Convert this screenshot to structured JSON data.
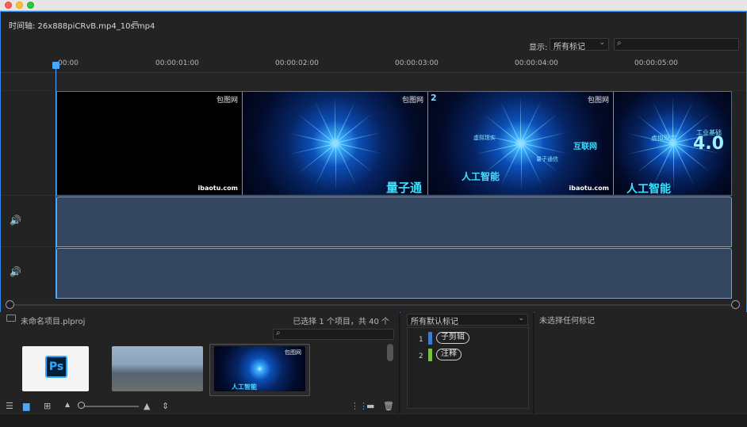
{
  "window": {
    "title": ""
  },
  "timeline": {
    "title": "时间轴: 26x888piCRvB.mp4_10s.mp4",
    "filter_label": "显示:",
    "filter_value": "所有标记",
    "search_placeholder": "",
    "ruler_labels": [
      "00:00",
      "00:00:01:00",
      "00:00:02:00",
      "00:00:03:00",
      "00:00:04:00",
      "00:00:05:00"
    ],
    "playhead": "00:00",
    "clips": [
      {
        "watermark": "包图网",
        "site": "ibaotu.com"
      },
      {
        "watermark": "包图网",
        "site": "",
        "overlay": "量子通"
      },
      {
        "watermark": "包图网",
        "site": "ibaotu.com",
        "overlay": "人工智能",
        "number": "2",
        "labels": [
          "虚拟现实",
          "互联网",
          "量子通信"
        ]
      },
      {
        "watermark": "",
        "site": "",
        "overlay": "人工智能",
        "labels": [
          "虚拟现实",
          "工业基础"
        ],
        "big": "4.0"
      }
    ]
  },
  "project": {
    "title": "未命名项目.plproj",
    "count": "已选择 1 个项目，共 40 个",
    "search_placeholder": "",
    "thumbs": [
      {
        "kind": "photoshop",
        "logo": "Ps"
      },
      {
        "kind": "city"
      },
      {
        "kind": "blue",
        "watermark": "包图网",
        "overlay": "人工智能"
      }
    ]
  },
  "markers": {
    "filter_value": "所有默认标记",
    "items": [
      {
        "index": "1",
        "label": "子剪辑",
        "color": "#3d7bd9"
      },
      {
        "index": "2",
        "label": "注释",
        "color": "#7bc043"
      }
    ]
  },
  "info": {
    "text": "未选择任何标记"
  }
}
